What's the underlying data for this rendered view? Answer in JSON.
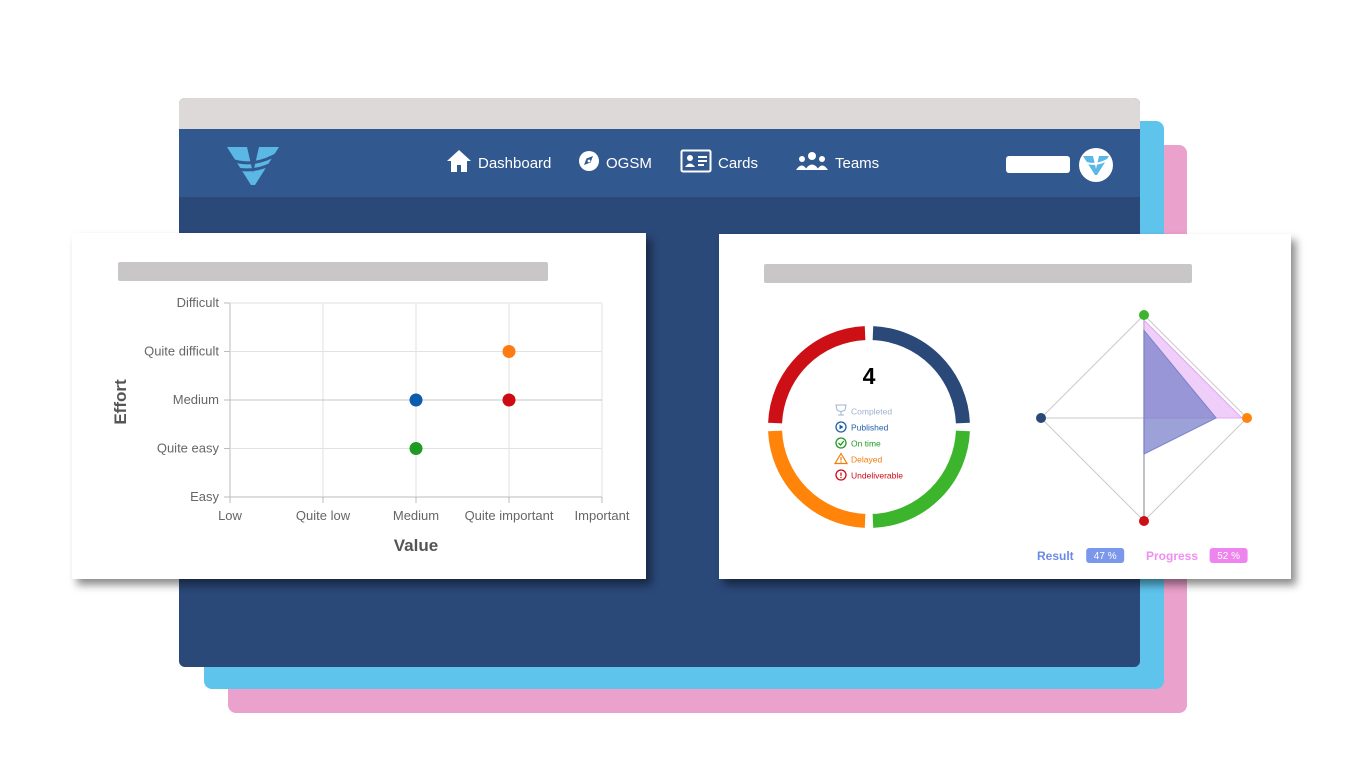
{
  "nav": {
    "items": [
      {
        "label": "Dashboard",
        "icon": "home-icon"
      },
      {
        "label": "OGSM",
        "icon": "compass-icon"
      },
      {
        "label": "Cards",
        "icon": "id-card-icon"
      },
      {
        "label": "Teams",
        "icon": "users-icon"
      }
    ]
  },
  "colors": {
    "navy": "#2a4878",
    "nav_bar": "#32598f",
    "blue_layer": "#5fc4ec",
    "pink_layer": "#eaa1cb",
    "logo_blue": "#5bb7e4"
  },
  "chart_data": [
    {
      "type": "scatter",
      "xlabel": "Value",
      "ylabel": "Effort",
      "x_categories": [
        "Low",
        "Quite low",
        "Medium",
        "Quite important",
        "Important"
      ],
      "y_categories": [
        "Easy",
        "Quite easy",
        "Medium",
        "Quite difficult",
        "Difficult"
      ],
      "grid": true,
      "points": [
        {
          "x": "Medium",
          "y": "Medium",
          "color": "#0b5cad"
        },
        {
          "x": "Medium",
          "y": "Quite easy",
          "color": "#1e9b22"
        },
        {
          "x": "Quite important",
          "y": "Quite difficult",
          "color": "#ff7b12"
        },
        {
          "x": "Quite important",
          "y": "Medium",
          "color": "#cc0a14"
        }
      ]
    },
    {
      "type": "pie",
      "center_value": "4",
      "slices": [
        {
          "label": "Published",
          "value": 1,
          "color": "#2a4878"
        },
        {
          "label": "On time",
          "value": 1,
          "color": "#3cb52c"
        },
        {
          "label": "Delayed",
          "value": 1,
          "color": "#ff8409"
        },
        {
          "label": "Undeliverable",
          "value": 1,
          "color": "#cc1016"
        }
      ],
      "legend": [
        {
          "label": "Completed",
          "color": "#9fb3cf",
          "icon": "trophy-icon"
        },
        {
          "label": "Published",
          "color": "#1f5fa8",
          "icon": "play-circle-icon"
        },
        {
          "label": "On time",
          "color": "#1e9b22",
          "icon": "check-circle-icon"
        },
        {
          "label": "Delayed",
          "color": "#f07c0a",
          "icon": "warning-icon"
        },
        {
          "label": "Undeliverable",
          "color": "#cc0a14",
          "icon": "alert-circle-icon"
        }
      ]
    },
    {
      "type": "radar",
      "axes": [
        {
          "color": "#3cb52c"
        },
        {
          "color": "#ff8409"
        },
        {
          "color": "#cc1016"
        },
        {
          "color": "#2a4878"
        }
      ],
      "max": 1,
      "series": [
        {
          "name": "Progress",
          "values": [
            0.95,
            0.95,
            0,
            0
          ],
          "color": "#e2a6f5",
          "badge": "52 %"
        },
        {
          "name": "Result",
          "values": [
            0.85,
            0.7,
            0.35,
            0
          ],
          "color": "#7b83c9",
          "badge": "47 %"
        }
      ]
    }
  ]
}
